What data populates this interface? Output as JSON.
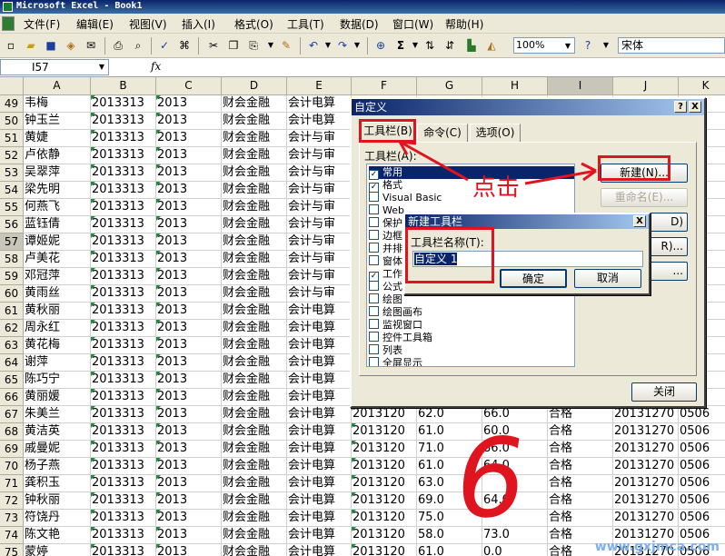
{
  "window": {
    "title": "Microsoft Excel - Book1"
  },
  "menu": [
    "文件(F)",
    "编辑(E)",
    "视图(V)",
    "插入(I)",
    "格式(O)",
    "工具(T)",
    "数据(D)",
    "窗口(W)",
    "帮助(H)"
  ],
  "toolbar": {
    "zoom": "100%",
    "font": "宋体"
  },
  "formula_bar": {
    "name_box": "I57",
    "fx": "fx"
  },
  "columns": [
    "A",
    "B",
    "C",
    "D",
    "E",
    "F",
    "G",
    "H",
    "I",
    "J",
    "K"
  ],
  "selected_column": "I",
  "selected_row": "57",
  "rows": [
    {
      "n": "49",
      "a": "韦梅",
      "b": "2013313",
      "c": "2013",
      "d": "财会金融",
      "e": "会计电算"
    },
    {
      "n": "50",
      "a": "钟玉兰",
      "b": "2013313",
      "c": "2013",
      "d": "财会金融",
      "e": "会计电算"
    },
    {
      "n": "51",
      "a": "黄婕",
      "b": "2013313",
      "c": "2013",
      "d": "财会金融",
      "e": "会计与审"
    },
    {
      "n": "52",
      "a": "卢依静",
      "b": "2013313",
      "c": "2013",
      "d": "财会金融",
      "e": "会计与审"
    },
    {
      "n": "53",
      "a": "吴翠萍",
      "b": "2013313",
      "c": "2013",
      "d": "财会金融",
      "e": "会计与审"
    },
    {
      "n": "54",
      "a": "梁先明",
      "b": "2013313",
      "c": "2013",
      "d": "财会金融",
      "e": "会计与审"
    },
    {
      "n": "55",
      "a": "何燕飞",
      "b": "2013313",
      "c": "2013",
      "d": "财会金融",
      "e": "会计与审"
    },
    {
      "n": "56",
      "a": "蓝钰倩",
      "b": "2013313",
      "c": "2013",
      "d": "财会金融",
      "e": "会计与审"
    },
    {
      "n": "57",
      "a": "谭姬妮",
      "b": "2013313",
      "c": "2013",
      "d": "财会金融",
      "e": "会计与审"
    },
    {
      "n": "58",
      "a": "卢美花",
      "b": "2013313",
      "c": "2013",
      "d": "财会金融",
      "e": "会计与审"
    },
    {
      "n": "59",
      "a": "邓冠萍",
      "b": "2013313",
      "c": "2013",
      "d": "财会金融",
      "e": "会计与审"
    },
    {
      "n": "60",
      "a": "黄雨丝",
      "b": "2013313",
      "c": "2013",
      "d": "财会金融",
      "e": "会计与审"
    },
    {
      "n": "61",
      "a": "黄秋丽",
      "b": "2013313",
      "c": "2013",
      "d": "财会金融",
      "e": "会计电算"
    },
    {
      "n": "62",
      "a": "周永红",
      "b": "2013313",
      "c": "2013",
      "d": "财会金融",
      "e": "会计电算"
    },
    {
      "n": "63",
      "a": "黄花梅",
      "b": "2013313",
      "c": "2013",
      "d": "财会金融",
      "e": "会计电算"
    },
    {
      "n": "64",
      "a": "谢萍",
      "b": "2013313",
      "c": "2013",
      "d": "财会金融",
      "e": "会计电算"
    },
    {
      "n": "65",
      "a": "陈巧宁",
      "b": "2013313",
      "c": "2013",
      "d": "财会金融",
      "e": "会计电算"
    },
    {
      "n": "66",
      "a": "黄丽媛",
      "b": "2013313",
      "c": "2013",
      "d": "财会金融",
      "e": "会计电算"
    },
    {
      "n": "67",
      "a": "朱美兰",
      "b": "2013313",
      "c": "2013",
      "d": "财会金融",
      "e": "会计电算",
      "f": "2013120",
      "g": "62.0",
      "h": "66.0",
      "i": "合格",
      "j": "20131270",
      "k": "0506"
    },
    {
      "n": "68",
      "a": "黄洁英",
      "b": "2013313",
      "c": "2013",
      "d": "财会金融",
      "e": "会计电算",
      "f": "2013120",
      "g": "61.0",
      "h": "60.0",
      "i": "合格",
      "j": "20131270",
      "k": "0506"
    },
    {
      "n": "69",
      "a": "戚曼妮",
      "b": "2013313",
      "c": "2013",
      "d": "财会金融",
      "e": "会计电算",
      "f": "2013120",
      "g": "71.0",
      "h": "86.0",
      "i": "合格",
      "j": "20131270",
      "k": "0506"
    },
    {
      "n": "70",
      "a": "杨子燕",
      "b": "2013313",
      "c": "2013",
      "d": "财会金融",
      "e": "会计电算",
      "f": "2013120",
      "g": "61.0",
      "h": "64.0",
      "i": "合格",
      "j": "20131270",
      "k": "0506"
    },
    {
      "n": "71",
      "a": "龚积玉",
      "b": "2013313",
      "c": "2013",
      "d": "财会金融",
      "e": "会计电算",
      "f": "2013120",
      "g": "63.0",
      "h": "",
      "i": "合格",
      "j": "20131270",
      "k": "0506"
    },
    {
      "n": "72",
      "a": "钟秋丽",
      "b": "2013313",
      "c": "2013",
      "d": "财会金融",
      "e": "会计电算",
      "f": "2013120",
      "g": "69.0",
      "h": "64.0",
      "i": "合格",
      "j": "20131270",
      "k": "0506"
    },
    {
      "n": "73",
      "a": "符饶丹",
      "b": "2013313",
      "c": "2013",
      "d": "财会金融",
      "e": "会计电算",
      "f": "2013120",
      "g": "75.0",
      "h": "",
      "i": "合格",
      "j": "20131270",
      "k": "0506"
    },
    {
      "n": "74",
      "a": "陈文艳",
      "b": "2013313",
      "c": "2013",
      "d": "财会金融",
      "e": "会计电算",
      "f": "2013120",
      "g": "58.0",
      "h": "73.0",
      "i": "合格",
      "j": "20131270",
      "k": "0506"
    },
    {
      "n": "75",
      "a": "蒙婷",
      "b": "2013313",
      "c": "2013",
      "d": "财会金融",
      "e": "会计电算",
      "f": "2013120",
      "g": "61.0",
      "h": "0.0",
      "i": "合格",
      "j": "20131270",
      "k": "0506"
    }
  ],
  "dialog": {
    "title": "自定义",
    "help": "?",
    "close": "X",
    "tabs": [
      "工具栏(B)",
      "命令(C)",
      "选项(O)"
    ],
    "list_label": "工具栏(A):",
    "toolbars": [
      {
        "label": "常用",
        "checked": true,
        "selected": true
      },
      {
        "label": "格式",
        "checked": true
      },
      {
        "label": "Visual Basic",
        "checked": false
      },
      {
        "label": "Web",
        "checked": false
      },
      {
        "label": "保护",
        "checked": false
      },
      {
        "label": "边框",
        "checked": false
      },
      {
        "label": "并排",
        "checked": false
      },
      {
        "label": "窗体",
        "checked": false
      },
      {
        "label": "工作",
        "checked": true
      },
      {
        "label": "公式",
        "checked": false
      },
      {
        "label": "绘图",
        "checked": false
      },
      {
        "label": "绘图画布",
        "checked": false
      },
      {
        "label": "监视窗口",
        "checked": false
      },
      {
        "label": "控件工具箱",
        "checked": false
      },
      {
        "label": "列表",
        "checked": false
      },
      {
        "label": "全屏显示",
        "checked": false
      }
    ],
    "buttons": {
      "new": "新建(N)...",
      "rename": "重命名(E)...",
      "b3": "D)",
      "b4": "R)...",
      "b5": "...",
      "close": "关闭"
    }
  },
  "subdialog": {
    "title": "新建工具栏",
    "close": "X",
    "name_label": "工具栏名称(T):",
    "name_value": "自定义 1",
    "ok": "确定",
    "cancel": "取消"
  },
  "annotations": {
    "click_label": "点击",
    "step": "6",
    "watermark": "www.gxjmca.com"
  }
}
